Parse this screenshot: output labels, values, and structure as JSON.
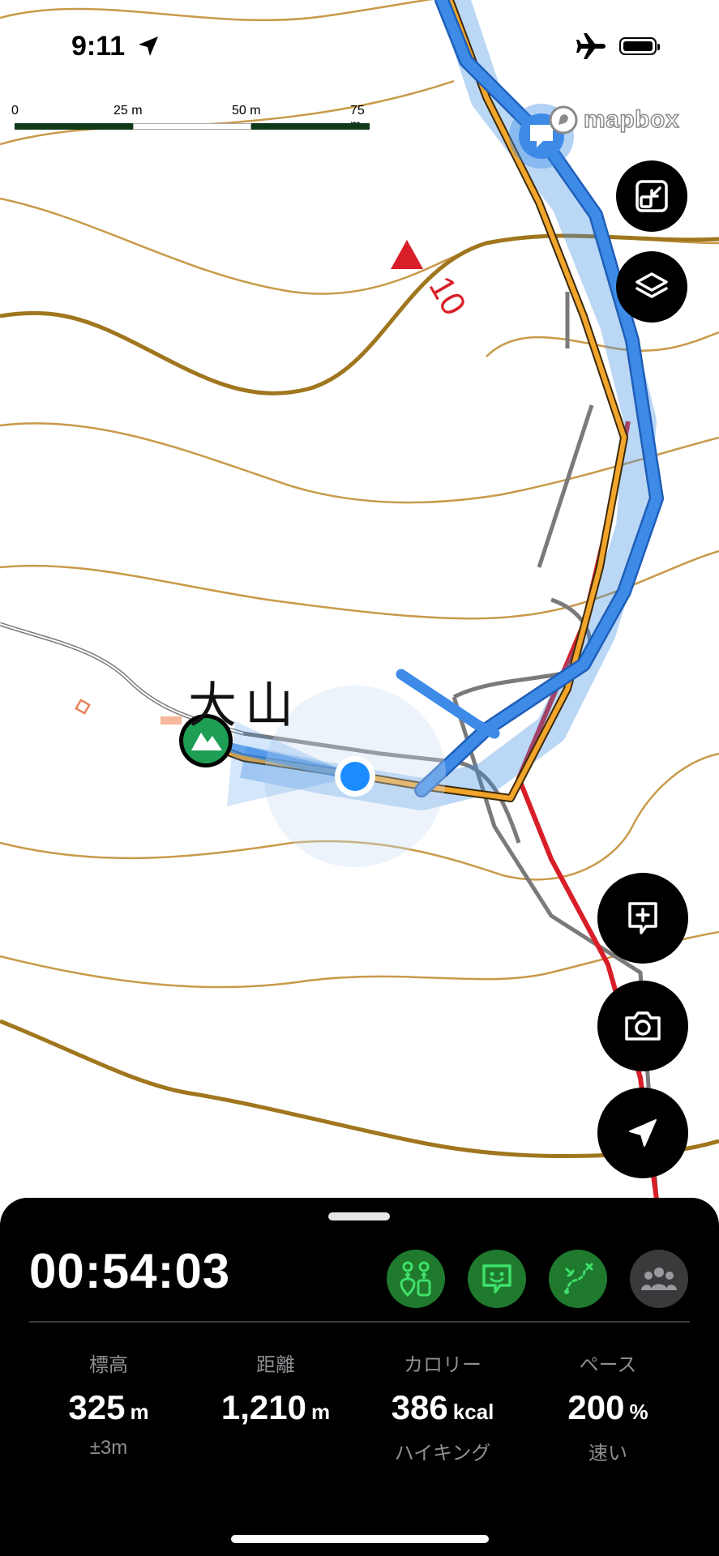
{
  "status_bar": {
    "time": "9:11"
  },
  "scale_bar": {
    "labels": [
      "0",
      "25 m",
      "50 m",
      "75 m"
    ]
  },
  "map": {
    "attribution": "mapbox",
    "peak_name": "大山",
    "contour_label": "10",
    "colors": {
      "route_planned": "#f2a52b",
      "route_recorded": "#3d8be6",
      "trail_red": "#d81e28",
      "contour": "#a0761e",
      "summit": "#1e9e55"
    }
  },
  "controls": {
    "fit_icon": "fit-to-route-icon",
    "layers_icon": "layers-icon",
    "add_note_icon": "add-note-icon",
    "camera_icon": "camera-icon",
    "locate_icon": "locate-arrow-icon"
  },
  "panel": {
    "elapsed": "00:54:03",
    "actions": [
      {
        "name": "marker-icon",
        "active": true
      },
      {
        "name": "message-icon",
        "active": true
      },
      {
        "name": "route-icon",
        "active": true
      },
      {
        "name": "group-icon",
        "active": false
      }
    ],
    "stats": {
      "elevation": {
        "label": "標高",
        "value": "325",
        "unit": "m",
        "sub": "±3m"
      },
      "distance": {
        "label": "距離",
        "value": "1,210",
        "unit": "m",
        "sub": ""
      },
      "calories": {
        "label": "カロリー",
        "value": "386",
        "unit": "kcal",
        "sub": "ハイキング"
      },
      "pace": {
        "label": "ペース",
        "value": "200",
        "unit": "%",
        "sub": "速い"
      }
    }
  }
}
